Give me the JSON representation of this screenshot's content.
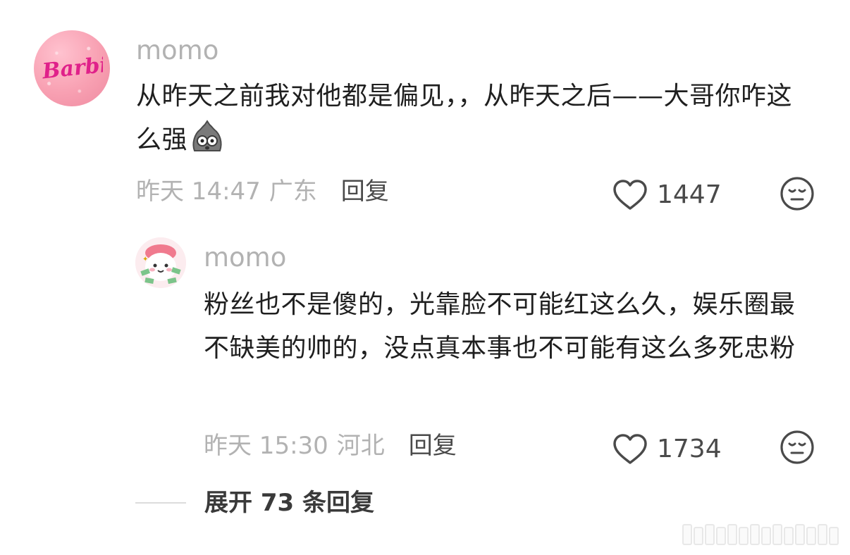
{
  "main_comment": {
    "avatar_text": "Barbie",
    "username": "momo",
    "text": "从昨天之前我对他都是偏见，，从昨天之后——大哥你咋这么强",
    "time": "昨天 14:47",
    "location": "广东",
    "reply_label": "回复",
    "likes": "1447"
  },
  "reply_comment": {
    "username": "momo",
    "text": "粉丝也不是傻的，光靠脸不可能红这么久，娱乐圈最不缺美的帅的，没点真本事也不可能有这么多死忠粉",
    "time": "昨天 15:30",
    "location": "河北",
    "reply_label": "回复",
    "likes": "1734"
  },
  "expand_replies": {
    "label": "展开 73 条回复"
  },
  "colors": {
    "meta_gray": "#b2b2b2",
    "text_dark": "#1f1f1f",
    "icon_gray": "#4a4a4a",
    "avatar_pink": "#f8a0b2",
    "barbie_magenta": "#e0218a"
  }
}
